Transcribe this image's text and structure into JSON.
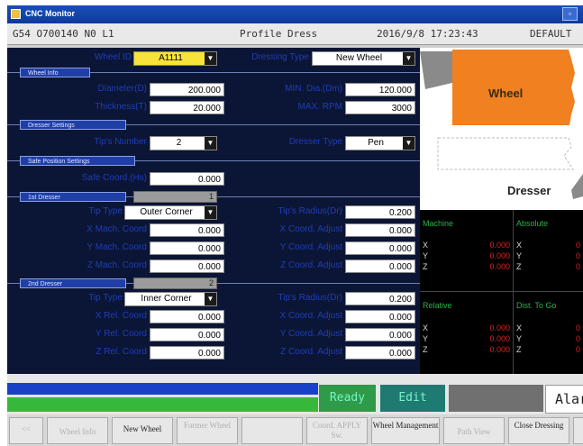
{
  "window": {
    "title": "CNC Monitor",
    "control_icon": "▫"
  },
  "status": {
    "left": "G54 O700140 N0 L1",
    "center": "Profile Dress",
    "datetime": "2016/9/8 17:23:43",
    "right": "DEFAULT"
  },
  "wheel": {
    "id_label": "Wheel ID",
    "id_value": "A1111",
    "dressing_type_label": "Dressing Type",
    "dressing_type_value": "New Wheel"
  },
  "wheel_info": {
    "section": "Wheel Info",
    "diameter_label": "Diameter(D)",
    "diameter": "200.000",
    "min_dia_label": "MIN. Dia.(Dm)",
    "min_dia": "120.000",
    "thickness_label": "Thickness(T)",
    "thickness": "20.000",
    "max_rpm_label": "MAX. RPM",
    "max_rpm": "3000"
  },
  "dresser_settings": {
    "section": "Dresser Settings",
    "tips_label": "Tip's Number",
    "tips_value": "2",
    "dresser_type_label": "Dresser Type",
    "dresser_type_value": "Pen"
  },
  "safe_position": {
    "section": "Safe Position Settings",
    "label": "Safe Coord.(Hs)",
    "value": "0.000"
  },
  "dresser1": {
    "section": "1st Dresser",
    "progress_text": "1",
    "progress_fraction": 1.0,
    "tip_type_label": "Tip Type",
    "tip_type_value": "Outer Corner",
    "tip_radius_label": "Tip's Radius(Dr)",
    "tip_radius": "0.200",
    "rows": [
      {
        "label": "X Mach. Coord",
        "value": "0.000",
        "adj_label": "X Coord. Adjust",
        "adj": "0.000"
      },
      {
        "label": "Y Mach. Coord",
        "value": "0.000",
        "adj_label": "Y Coord. Adjust",
        "adj": "0.000"
      },
      {
        "label": "Z Mach. Coord",
        "value": "0.000",
        "adj_label": "Z Coord. Adjust",
        "adj": "0.000"
      }
    ]
  },
  "dresser2": {
    "section": "2nd Dresser",
    "progress_text": "2",
    "progress_fraction": 1.0,
    "tip_type_label": "Tip Type",
    "tip_type_value": "Inner Corner",
    "tip_radius_label": "Tip's Radius(Dr)",
    "tip_radius": "0.200",
    "rows": [
      {
        "label": "X Rel. Coord",
        "value": "0.000",
        "adj_label": "X Coord. Adjust",
        "adj": "0.000"
      },
      {
        "label": "Y Rel. Coord",
        "value": "0.000",
        "adj_label": "Y Coord. Adjust",
        "adj": "0.000"
      },
      {
        "label": "Z Rel. Coord",
        "value": "0.000",
        "adj_label": "Z Coord. Adjust",
        "adj": "0.000"
      }
    ]
  },
  "diagram": {
    "wheel_label": "Wheel",
    "dresser_label": "Dresser"
  },
  "coords": {
    "machine": {
      "title": "Machine",
      "x": "0.000",
      "y": "0.000",
      "z": "0.000"
    },
    "absolute": {
      "title": "Absolute",
      "x": "0",
      "y": "0",
      "z": "0"
    },
    "relative": {
      "title": "Relative",
      "x": "0.000",
      "y": "0.000",
      "z": "0.000"
    },
    "dist_to_go": {
      "title": "Dist. To Go",
      "x": "0",
      "y": "0",
      "z": "0"
    },
    "axes": [
      "X",
      "Y",
      "Z"
    ]
  },
  "mode": {
    "state": "Ready",
    "mode": "Edit",
    "alarm": "Alarm"
  },
  "softkeys": [
    "<<",
    "Wheel Info",
    "New Wheel",
    "Former Wheel",
    "",
    "Coord. APPLY Sw.",
    "Wheel Management",
    "Path View",
    "Close Dressing"
  ],
  "colors": {
    "panel_bg": "#0b1535",
    "label_blue": "#1f3db8",
    "wheel_orange": "#f08020",
    "coord_green": "#2bb34a",
    "coord_red": "#e02020",
    "ready_green": "#38b83a"
  }
}
